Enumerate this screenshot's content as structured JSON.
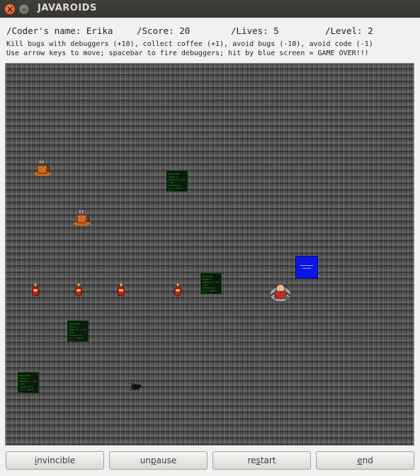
{
  "window": {
    "title": "JAVAROIDS",
    "close_glyph": "×",
    "min_glyph": "–"
  },
  "hud": {
    "coder": "/Coder's name: Erika",
    "score": "/Score: 20",
    "lives": "/Lives: 5",
    "level": "/Level: 2"
  },
  "info": {
    "line1": "Kill bugs with debuggers (+10), collect coffee (+1), avoid bugs (-10), avoid code (-1)",
    "line2": "Use arrow keys to move; spacebar to fire debuggers; hit by blue screen = GAME OVER!!!"
  },
  "buttons": {
    "invincible": {
      "mnemonic": "i",
      "rest": "nvincible"
    },
    "unpause": {
      "pre": "un",
      "mnemonic": "p",
      "rest": "ause"
    },
    "restart": {
      "pre": "re",
      "mnemonic": "s",
      "rest": "tart"
    },
    "end": {
      "mnemonic": "e",
      "rest": "nd"
    }
  },
  "code_snippet": "#include stdio.h\n#define\n{ int i=0;\n while(i<n)\n i++;\n return 0; }",
  "icons": {
    "coffee": "coffee-cup-icon",
    "debugger": "debugger-bomb-icon",
    "bug": "bug-icon",
    "player": "coder-ship-icon",
    "bsod": "blue-screen-icon",
    "code": "code-block-icon"
  }
}
